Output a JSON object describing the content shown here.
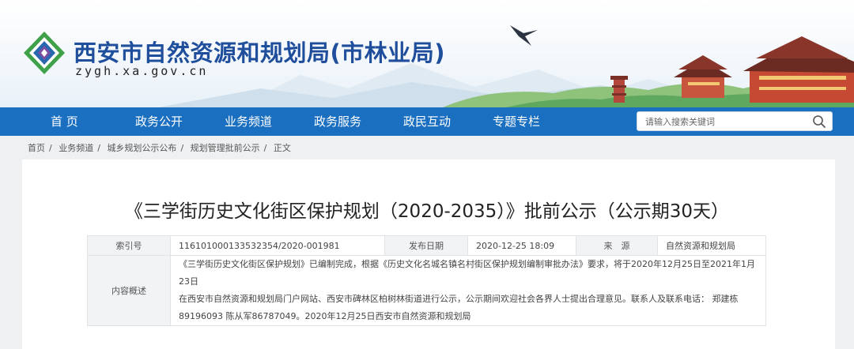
{
  "header": {
    "site_title": "西安市自然资源和规划局(市林业局)",
    "domain": "zygh.xa.gov.cn"
  },
  "nav": {
    "items": [
      "首 页",
      "政务公开",
      "业务频道",
      "政务服务",
      "政民互动",
      "专题专栏"
    ]
  },
  "search": {
    "placeholder": "请输入搜索关键词",
    "icon": "search-icon"
  },
  "breadcrumb": [
    "首页",
    "业务频道",
    "城乡规划公示公布",
    "规划管理批前公示",
    "正文"
  ],
  "article": {
    "title": "《三学街历史文化街区保护规划（2020-2035）》批前公示（公示期30天）",
    "meta": {
      "index_label": "索引号",
      "index_value": "11610100013353235​4/2020-001981",
      "date_label": "发布日期",
      "date_value": "2020-12-25 18:09",
      "source_label": "来　源",
      "source_value": "自然资源和规划局",
      "summary_label": "内容概述",
      "summary_lines": [
        "《三学街历史文化街区保护规划》已编制完成，根据《历史文化名城名镇名村街区保护规划编制审批办法》要求，将于2020年12月25日至2021年1月23日",
        "在西安市自然资源和规划局门户网站、西安市碑林区柏树林街道进行公示，公示期间欢迎社会各界人士提出合理意见。联系人及联系电话： 郑建栋",
        "89196093 陈从军86787049。2020年12月25日西安市自然资源和规划局"
      ]
    }
  },
  "colors": {
    "nav_bg": "#1a6fc1",
    "title_blue": "#1f4e9c",
    "page_bg": "#eef0f2"
  }
}
